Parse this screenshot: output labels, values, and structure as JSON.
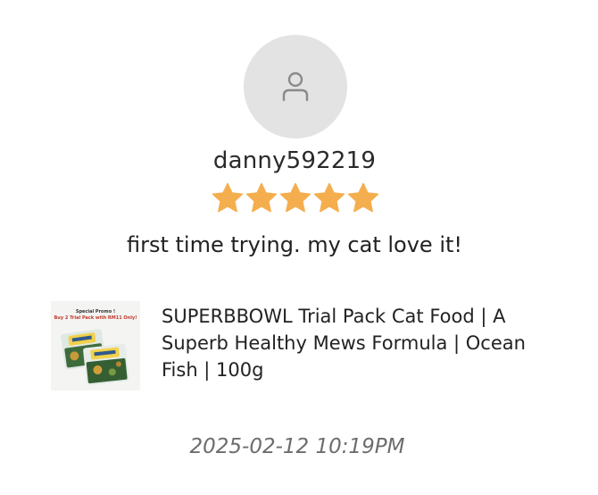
{
  "review": {
    "username": "danny592219",
    "rating": 5,
    "rating_max": 5,
    "comment": "first time trying. my cat love it!",
    "timestamp": "2025-02-12 10:19PM"
  },
  "product": {
    "title": "SUPERBBOWL Trial Pack Cat Food | A Superb Healthy Mews Formula | Ocean Fish | 100g",
    "thumbnail_text_1": "Special Promo !",
    "thumbnail_text_2": "Buy 2 Trial Pack with RM11 Only!"
  },
  "colors": {
    "star": "#F5AE4E",
    "avatar_bg": "#E3E3E3",
    "avatar_icon": "#8A8A8A",
    "timestamp": "#6D6D6D"
  },
  "icons": {
    "avatar": "user-icon",
    "rating": "star-icon"
  }
}
